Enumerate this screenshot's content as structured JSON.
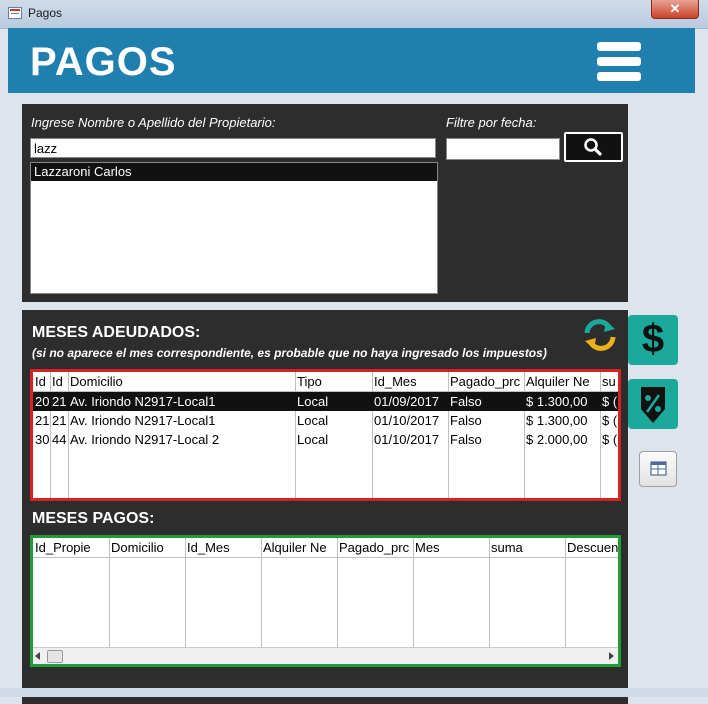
{
  "window": {
    "title": "Pagos",
    "close_glyph": "✕"
  },
  "header": {
    "title": "PAGOS",
    "menu_icon": "hamburger-menu-icon"
  },
  "search": {
    "owner_label": "Ingrese Nombre o Apellido del Propietario:",
    "owner_value": "lazz",
    "date_label": "Filtre por fecha:",
    "date_value": "",
    "results": [
      "Lazzaroni Carlos"
    ]
  },
  "adeudados": {
    "title": "MESES ADEUDADOS:",
    "note": "(si no aparece el mes correspondiente, es probable que no haya ingresado los impuestos)",
    "columns": [
      "Id",
      "Id",
      "Domicilio",
      "Tipo",
      "Id_Mes",
      "Pagado_prc",
      "Alquiler Ne",
      "su"
    ],
    "rows": [
      [
        "20",
        "21",
        "Av. Iriondo N2917-Local1",
        "Local",
        "01/09/2017",
        "Falso",
        "$ 1.300,00",
        "$ ("
      ],
      [
        "21",
        "21",
        "Av. Iriondo N2917-Local1",
        "Local",
        "01/10/2017",
        "Falso",
        "$ 1.300,00",
        "$ ("
      ],
      [
        "30",
        "44",
        "Av. Iriondo N2917-Local 2",
        "Local",
        "01/10/2017",
        "Falso",
        "$ 2.000,00",
        "$ ("
      ]
    ],
    "selected_row": 0,
    "border_color": "#d92020"
  },
  "pagos": {
    "title": "MESES PAGOS:",
    "columns": [
      "Id_Propie",
      "Domicilio",
      "Id_Mes",
      "Alquiler Ne",
      "Pagado_prc",
      "Mes",
      "suma",
      "Descuen"
    ],
    "rows": [],
    "border_color": "#1f9d3a"
  },
  "side_buttons": {
    "dollar": "$",
    "refresh_icon": "refresh-icon",
    "percent_icon": "percent-tag-icon",
    "small_icon": "table-icon"
  },
  "colors": {
    "header": "#1f7fae",
    "panel": "#2d2d2d",
    "accent_teal": "#1aa99a"
  }
}
